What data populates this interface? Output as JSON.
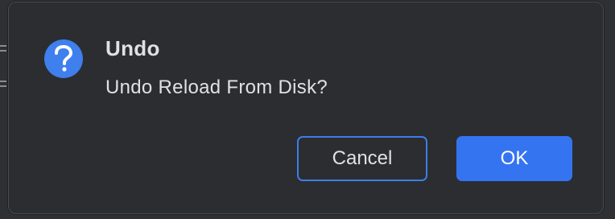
{
  "dialog": {
    "title": "Undo",
    "message": "Undo Reload From Disk?",
    "icon": "question-icon",
    "buttons": {
      "cancel_label": "Cancel",
      "ok_label": "OK"
    }
  },
  "colors": {
    "accent": "#3574f0",
    "dialog_bg": "#2b2d31",
    "text": "#dfe1e5"
  }
}
